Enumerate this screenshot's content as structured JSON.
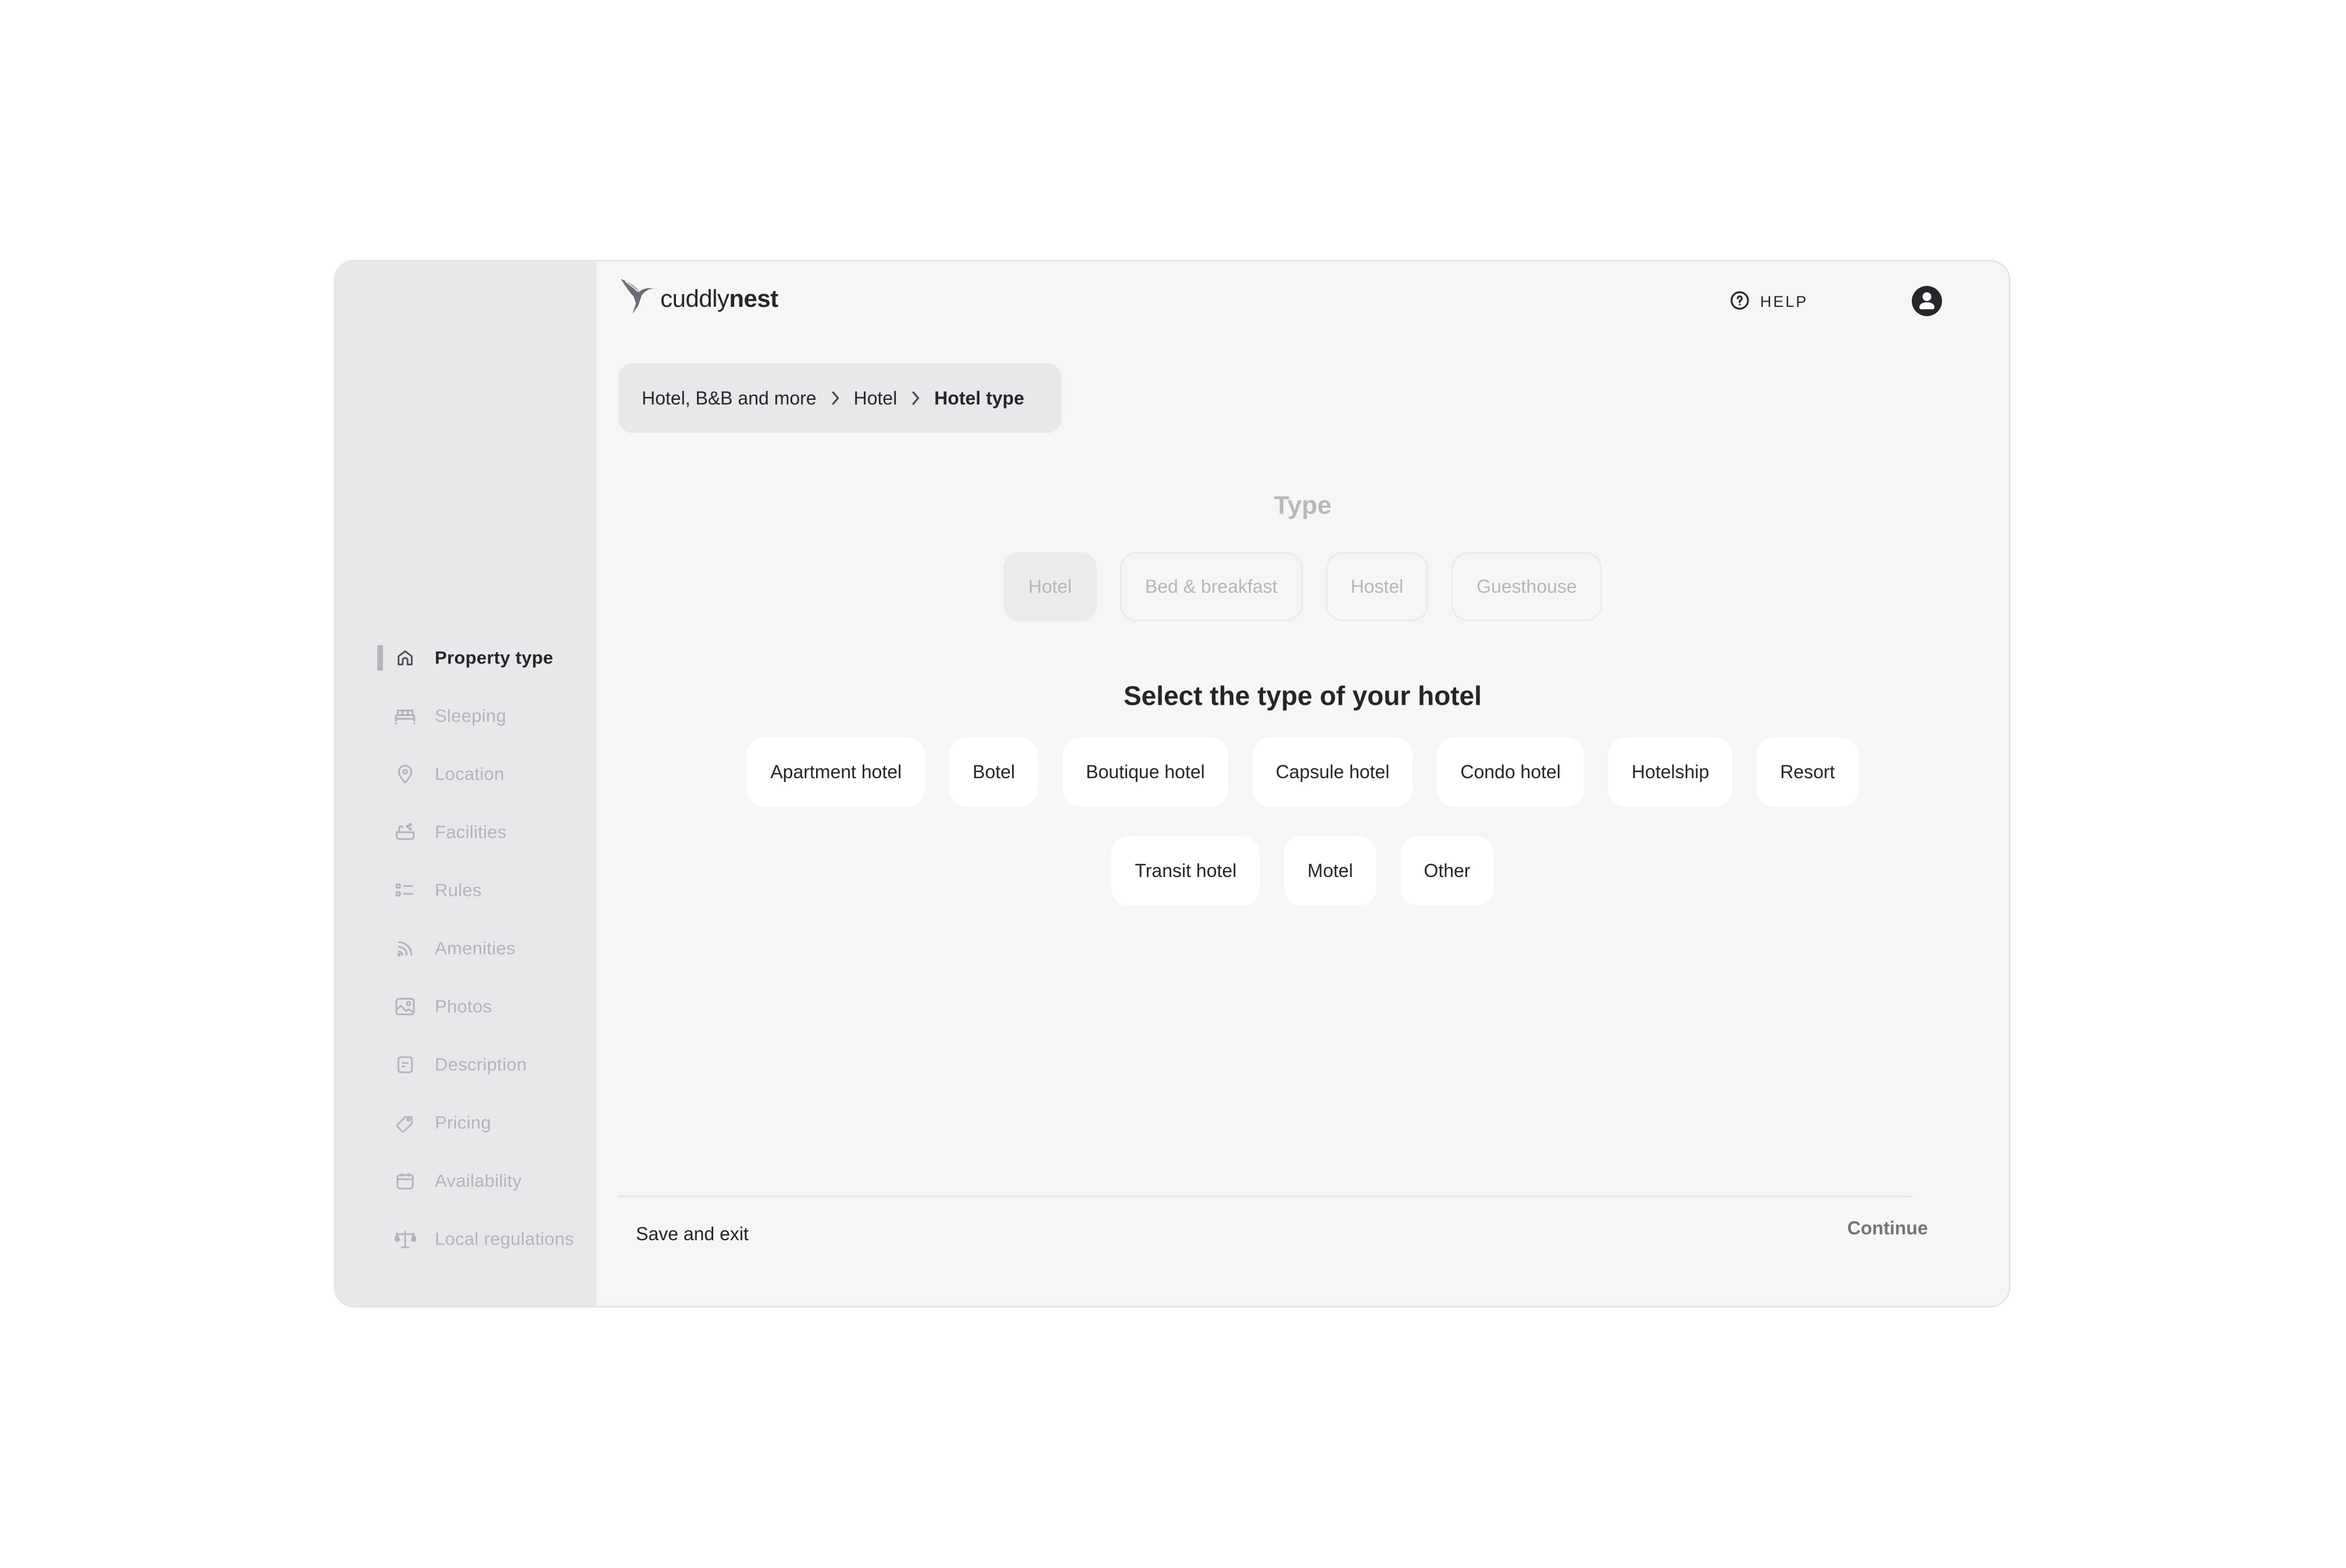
{
  "brand": {
    "name_light": "cuddly",
    "name_bold": "nest",
    "logo_icon": "hummingbird-icon"
  },
  "header": {
    "help_label": "HELP",
    "help_icon": "question-circle-icon",
    "account_icon": "user-circle-icon"
  },
  "sidebar": {
    "active_index": 0,
    "items": [
      {
        "label": "Property type",
        "icon": "home-icon"
      },
      {
        "label": "Sleeping",
        "icon": "bed-icon"
      },
      {
        "label": "Location",
        "icon": "map-pin-icon"
      },
      {
        "label": "Facilities",
        "icon": "bathtub-icon"
      },
      {
        "label": "Rules",
        "icon": "list-icon"
      },
      {
        "label": "Amenities",
        "icon": "wifi-icon"
      },
      {
        "label": "Photos",
        "icon": "image-icon"
      },
      {
        "label": "Description",
        "icon": "document-icon"
      },
      {
        "label": "Pricing",
        "icon": "tag-icon"
      },
      {
        "label": "Availability",
        "icon": "calendar-icon"
      },
      {
        "label": "Local regulations",
        "icon": "scale-icon"
      }
    ]
  },
  "breadcrumb": {
    "items": [
      "Hotel, B&B and more",
      "Hotel",
      "Hotel type"
    ]
  },
  "type_section": {
    "title": "Type",
    "options": [
      "Hotel",
      "Bed & breakfast",
      "Hostel",
      "Guesthouse"
    ],
    "selected": "Hotel"
  },
  "hotel_type_section": {
    "title": "Select the type of your hotel",
    "row1": [
      "Apartment hotel",
      "Botel",
      "Boutique hotel",
      "Capsule hotel",
      "Condo hotel",
      "Hotelship",
      "Resort"
    ],
    "row2": [
      "Transit hotel",
      "Motel",
      "Other"
    ]
  },
  "footer": {
    "save_exit_label": "Save and exit",
    "continue_label": "Continue"
  },
  "colors": {
    "sidebar_bg": "#e8e8ea",
    "main_bg": "#f6f6f6",
    "text_primary": "#25252a",
    "text_muted": "#b4b3b9",
    "continue_disabled": "#75747c"
  }
}
